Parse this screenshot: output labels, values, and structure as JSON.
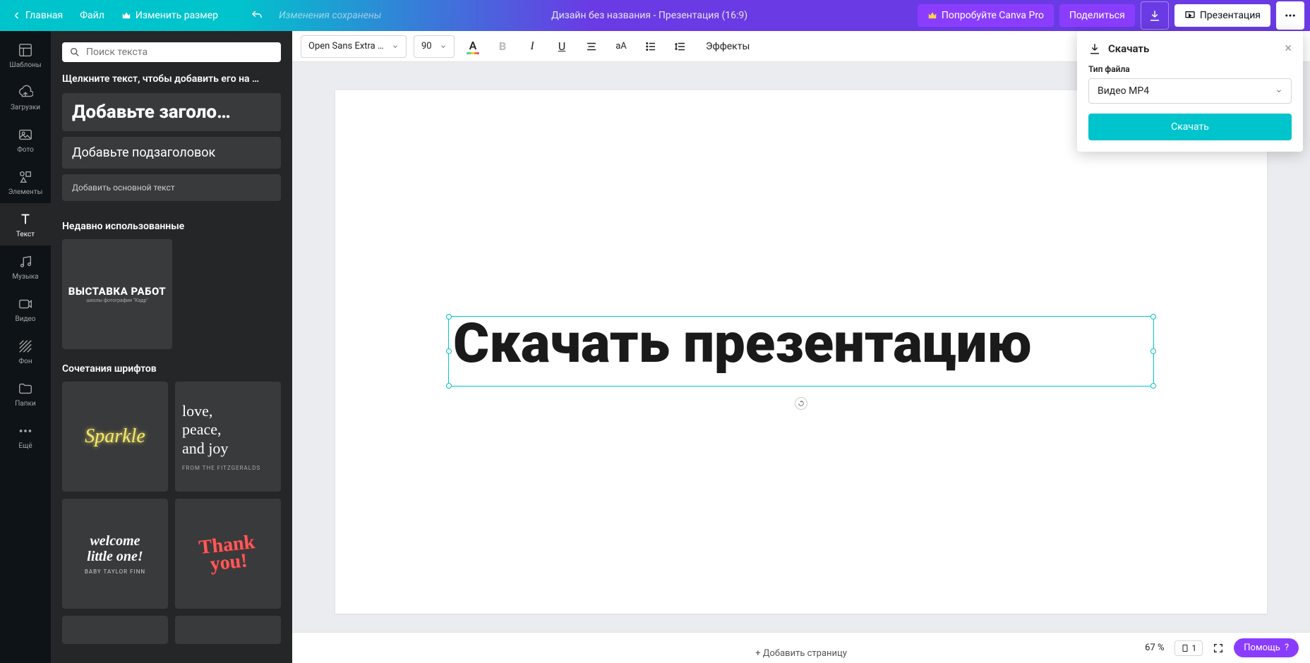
{
  "header": {
    "home": "Главная",
    "file": "Файл",
    "resize": "Изменить размер",
    "saved": "Изменения сохранены",
    "title": "Дизайн без названия - Презентация (16:9)",
    "try_pro": "Попробуйте Canva Pro",
    "share": "Поделиться",
    "present": "Презентация"
  },
  "rail": {
    "templates": "Шаблоны",
    "uploads": "Загрузки",
    "photos": "Фото",
    "elements": "Элементы",
    "text": "Текст",
    "music": "Музыка",
    "video": "Видео",
    "background": "Фон",
    "folders": "Папки",
    "more": "Ещё"
  },
  "side": {
    "search_placeholder": "Поиск текста",
    "hint": "Щелкните текст, чтобы добавить его на …",
    "add_heading": "Добавьте заголо…",
    "add_subheading": "Добавьте подзаголовок",
    "add_body": "Добавить основной текст",
    "recent_title": "Недавно использованные",
    "recent_card_title": "ВЫСТАВКА РАБОТ",
    "recent_card_sub": "школы фотографии \"Кадр\"",
    "combos_title": "Сочетания шрифтов",
    "card_sparkle": "Sparkle",
    "card_love": "love,\npeace,\nand joy",
    "card_love_sub": "FROM THE FITZGERALDS",
    "card_welcome": "welcome\nlittle one!",
    "card_welcome_sub": "BABY TAYLOR FINN",
    "card_thanks": "Thank\nyou!"
  },
  "toolbar": {
    "font_name": "Open Sans Extra …",
    "font_size": "90",
    "effects": "Эффекты"
  },
  "canvas": {
    "text": "Скачать презентацию",
    "add_page": "+ Добавить страницу"
  },
  "popover": {
    "title": "Скачать",
    "file_type_label": "Тип файла",
    "file_type_value": "Видео MP4",
    "download_btn": "Скачать"
  },
  "bottom": {
    "zoom": "67 %",
    "page": "1",
    "help": "Помощь",
    "help_q": "?"
  }
}
